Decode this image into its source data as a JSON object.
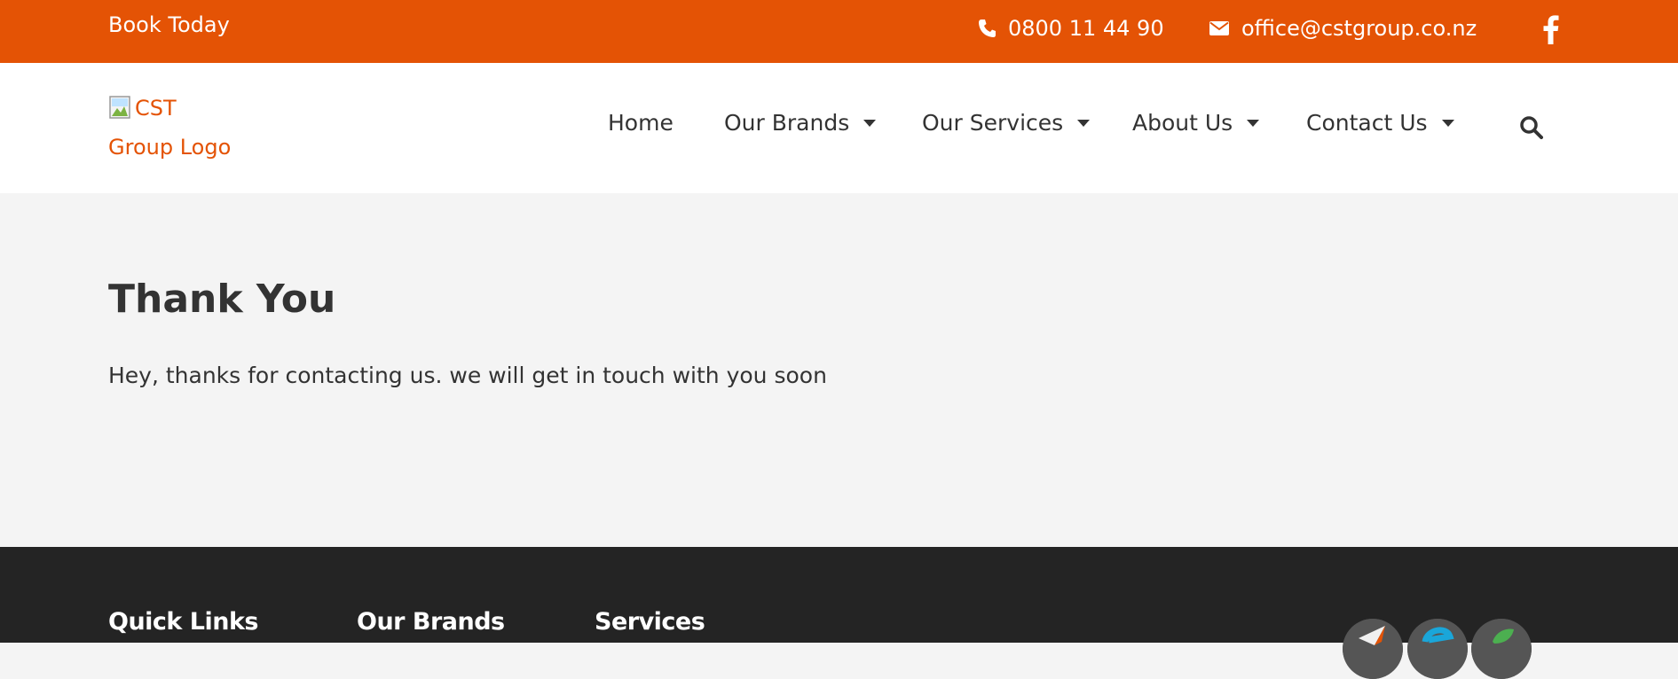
{
  "topbar": {
    "book_label": "Book Today",
    "phone": "0800 11 44 90",
    "email": "office@cstgroup.co.nz",
    "facebook_icon": "facebook-icon",
    "phone_icon": "phone-icon",
    "email_icon": "envelope-icon",
    "color": "#e45305"
  },
  "header": {
    "logo_alt_line1": "CST",
    "logo_alt_line2": "Group Logo",
    "nav": [
      {
        "label": "Home"
      },
      {
        "label": "Our Brands"
      },
      {
        "label": "Our Services"
      },
      {
        "label": "About Us"
      },
      {
        "label": "Contact Us"
      }
    ],
    "search_icon": "search-icon"
  },
  "main": {
    "title": "Thank You",
    "message": "Hey, thanks for contacting us. we will get in touch with you soon"
  },
  "footer": {
    "columns": [
      {
        "title": "Quick Links"
      },
      {
        "title": "Our Brands"
      },
      {
        "title": "Services"
      }
    ],
    "badges": [
      "paper-plane-badge-icon",
      "e-logo-badge-icon",
      "leaf-badge-icon"
    ]
  }
}
